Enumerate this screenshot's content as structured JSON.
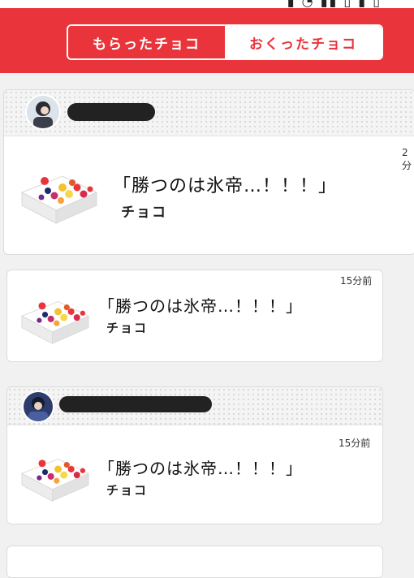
{
  "tabs": {
    "received_label": "もらったチョコ",
    "sent_label": "おくったチョコ",
    "active": "received"
  },
  "colors": {
    "brand_red": "#e8343a",
    "card_bg": "#ffffff",
    "page_bg": "#f1f1f1"
  },
  "cards": [
    {
      "time": "2分",
      "title": "「勝つのは氷帝…！！！」",
      "subtitle": "チョコ",
      "sender_name_redacted": true
    },
    {
      "time": "15分前",
      "title": "「勝つのは氷帝…！！！」",
      "subtitle": "チョコ"
    },
    {
      "time": "15分前",
      "title": "「勝つのは氷帝…！！！」",
      "subtitle": "チョコ",
      "sender_name_redacted": true
    }
  ]
}
